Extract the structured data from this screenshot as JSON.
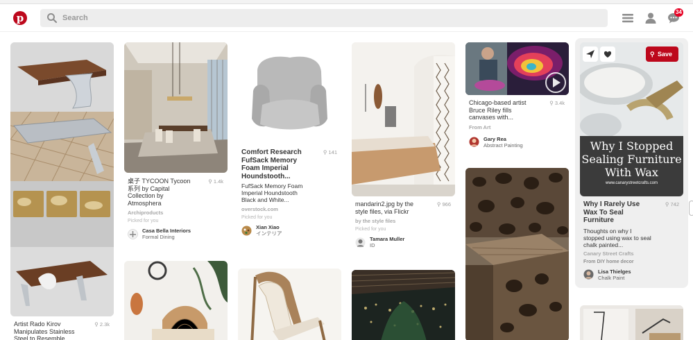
{
  "search": {
    "placeholder": "Search"
  },
  "notifications": {
    "count": "34"
  },
  "colors": {
    "brand": "#bd081c",
    "save": "#bd081c"
  },
  "pins": [
    {
      "title": "Artist Rado Kirov Manipulates Stainless Steel to Resemble...",
      "saves": "2.3k"
    },
    {
      "title": "桌子 TYCOON Tycoon 系列 by Capital Collection by Atmosphera",
      "saves": "1.4k",
      "source": "Archiproducts",
      "picked": "Picked for you",
      "attr_name": "Casa Bella Interiors",
      "attr_board": "Formal Dining"
    },
    {
      "title": "Comfort Research FufSack Memory Foam Imperial Houndstooth...",
      "saves": "141",
      "desc": "FufSack Memory Foam Imperial Houndstooth Black and White...",
      "source": "overstock.com",
      "picked": "Picked for you",
      "attr_name": "Xian Xiao",
      "attr_board": "インテリア"
    },
    {
      "title": "mandarin2.jpg by the style files, via Flickr",
      "saves": "966",
      "source": "by the style files",
      "picked": "Picked for you",
      "attr_name": "Tamara Muller",
      "attr_board": "ID"
    },
    {
      "title": "Chicago-based artist Bruce Riley fills canvases with...",
      "saves": "3.4k",
      "source": "From Art",
      "attr_name": "Gary Rea",
      "attr_board": "Abstract Painting"
    },
    {
      "title": "Why I Rarely Use Wax To Seal Furniture",
      "saves": "742",
      "desc": "Thoughts on why I stopped using wax to seal chalk painted...",
      "source": "Canary Street Crafts",
      "picked": "From DIY home decor",
      "attr_name": "Lisa Thielges",
      "attr_board": "Chalk Paint",
      "image_text_1": "Why I Stopped",
      "image_text_2": "Sealing Furniture",
      "image_text_3": "With Wax",
      "image_url_text": "www.canarystreetcrafts.com"
    }
  ],
  "actions": {
    "save_label": "Save"
  }
}
